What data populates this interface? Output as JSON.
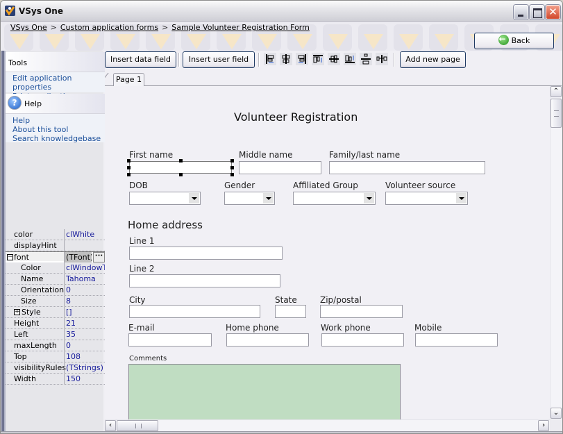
{
  "window": {
    "title": "VSys One",
    "controls": {
      "minimize": "_",
      "maximize": "□",
      "close": "✕"
    }
  },
  "breadcrumb": {
    "items": [
      "VSys One",
      "Custom application forms",
      "Sample Volunteer Registration Form"
    ],
    "separator": ">"
  },
  "header": {
    "back_label": "Back"
  },
  "toolbar": {
    "insert_data_field": "Insert data field",
    "insert_user_field": "Insert user field",
    "add_new_page": "Add new page",
    "align_icons": [
      "align-left-icon",
      "align-center-horizontal-icon",
      "align-right-icon",
      "align-top-icon",
      "align-center-vertical-icon",
      "align-bottom-icon",
      "space-vertical-icon",
      "space-horizontal-icon"
    ]
  },
  "tabs": [
    {
      "label": "Page 1",
      "active": true
    }
  ],
  "sidebar": {
    "tools": {
      "title": "Tools",
      "links": [
        "Edit application properties",
        "Print application"
      ]
    },
    "help": {
      "title": "Help",
      "links": [
        "Help",
        "About this tool",
        "Search knowledgebase"
      ]
    },
    "properties": [
      {
        "name": "color",
        "value": "clWhite"
      },
      {
        "name": "displayHint",
        "value": ""
      },
      {
        "name": "font",
        "value": "(TFont)",
        "expanded": true
      },
      {
        "name": "Color",
        "value": "clWindowText"
      },
      {
        "name": "Name",
        "value": "Tahoma"
      },
      {
        "name": "Orientation",
        "value": "0"
      },
      {
        "name": "Size",
        "value": "8"
      },
      {
        "name": "Style",
        "value": "[]",
        "collapsed": true
      },
      {
        "name": "Height",
        "value": "21"
      },
      {
        "name": "Left",
        "value": "35"
      },
      {
        "name": "maxLength",
        "value": "0"
      },
      {
        "name": "Top",
        "value": "108"
      },
      {
        "name": "visibilityRules",
        "value": "(TStrings)"
      },
      {
        "name": "Width",
        "value": "150"
      }
    ]
  },
  "form": {
    "title": "Volunteer Registration",
    "fields": {
      "first_name": {
        "label": "First name",
        "value": "",
        "selected": true
      },
      "middle_name": {
        "label": "Middle name",
        "value": ""
      },
      "family_name": {
        "label": "Family/last name",
        "value": ""
      },
      "dob": {
        "label": "DOB",
        "value": ""
      },
      "gender": {
        "label": "Gender",
        "value": ""
      },
      "affiliated_group": {
        "label": "Affiliated Group",
        "value": ""
      },
      "volunteer_source": {
        "label": "Volunteer source",
        "value": ""
      }
    },
    "home_address": {
      "heading": "Home address",
      "line1": {
        "label": "Line 1",
        "value": ""
      },
      "line2": {
        "label": "Line 2",
        "value": ""
      },
      "city": {
        "label": "City",
        "value": ""
      },
      "state": {
        "label": "State",
        "value": ""
      },
      "zip": {
        "label": "Zip/postal",
        "value": ""
      }
    },
    "contact": {
      "email": {
        "label": "E-mail",
        "value": ""
      },
      "home_phone": {
        "label": "Home phone",
        "value": ""
      },
      "work_phone": {
        "label": "Work phone",
        "value": ""
      },
      "mobile": {
        "label": "Mobile",
        "value": ""
      }
    },
    "comments": {
      "label": "Comments",
      "value": ""
    }
  },
  "colors": {
    "link": "#1b4f9a",
    "property_value": "#15199a",
    "comments_bg": "#c0ddc2",
    "button_border": "#1f3a63"
  }
}
